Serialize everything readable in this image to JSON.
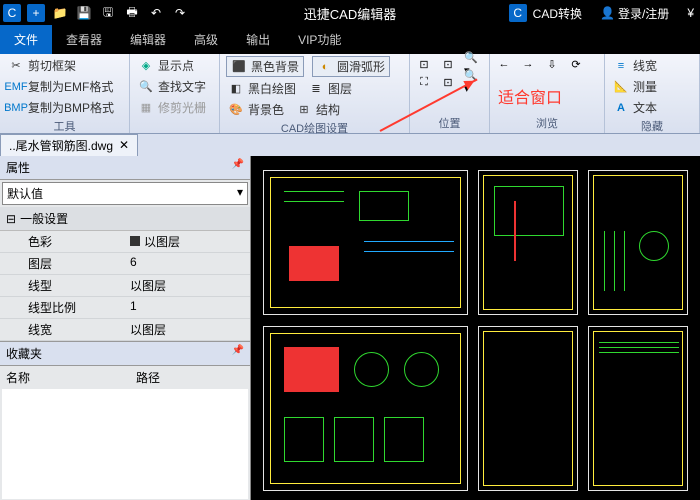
{
  "titlebar": {
    "app_title": "迅捷CAD编辑器",
    "convert": "CAD转换",
    "login": "登录/注册",
    "currency": "¥"
  },
  "tabs": {
    "file": "文件",
    "viewer": "查看器",
    "editor": "编辑器",
    "advanced": "高级",
    "output": "输出",
    "vip": "VIP功能"
  },
  "ribbon": {
    "tools": {
      "clip": "剪切框架",
      "emf": "复制为EMF格式",
      "bmp": "复制为BMP格式",
      "label": "工具"
    },
    "find": {
      "point": "显示点",
      "text": "查找文字",
      "polish": "修剪光栅"
    },
    "cad": {
      "bg_black": "黑色背景",
      "arc": "圆滑弧形",
      "bw": "黑白绘图",
      "layer": "图层",
      "bgcolor": "背景色",
      "struct": "结构",
      "label": "CAD绘图设置"
    },
    "pos": {
      "label": "位置"
    },
    "browse": {
      "label": "浏览"
    },
    "hide": {
      "linew": "线宽",
      "measure": "测量",
      "text": "文本",
      "label": "隐藏"
    }
  },
  "doc": {
    "name": "..尾水管钢筋图.dwg"
  },
  "props": {
    "title": "属性",
    "default": "默认值",
    "general": "一般设置",
    "rows": [
      {
        "k": "色彩",
        "v": "■以图层"
      },
      {
        "k": "图层",
        "v": "6"
      },
      {
        "k": "线型",
        "v": "以图层"
      },
      {
        "k": "线型比例",
        "v": "1"
      },
      {
        "k": "线宽",
        "v": "以图层"
      }
    ]
  },
  "fav": {
    "title": "收藏夹",
    "name": "名称",
    "path": "路径"
  },
  "callout": "适合窗口"
}
